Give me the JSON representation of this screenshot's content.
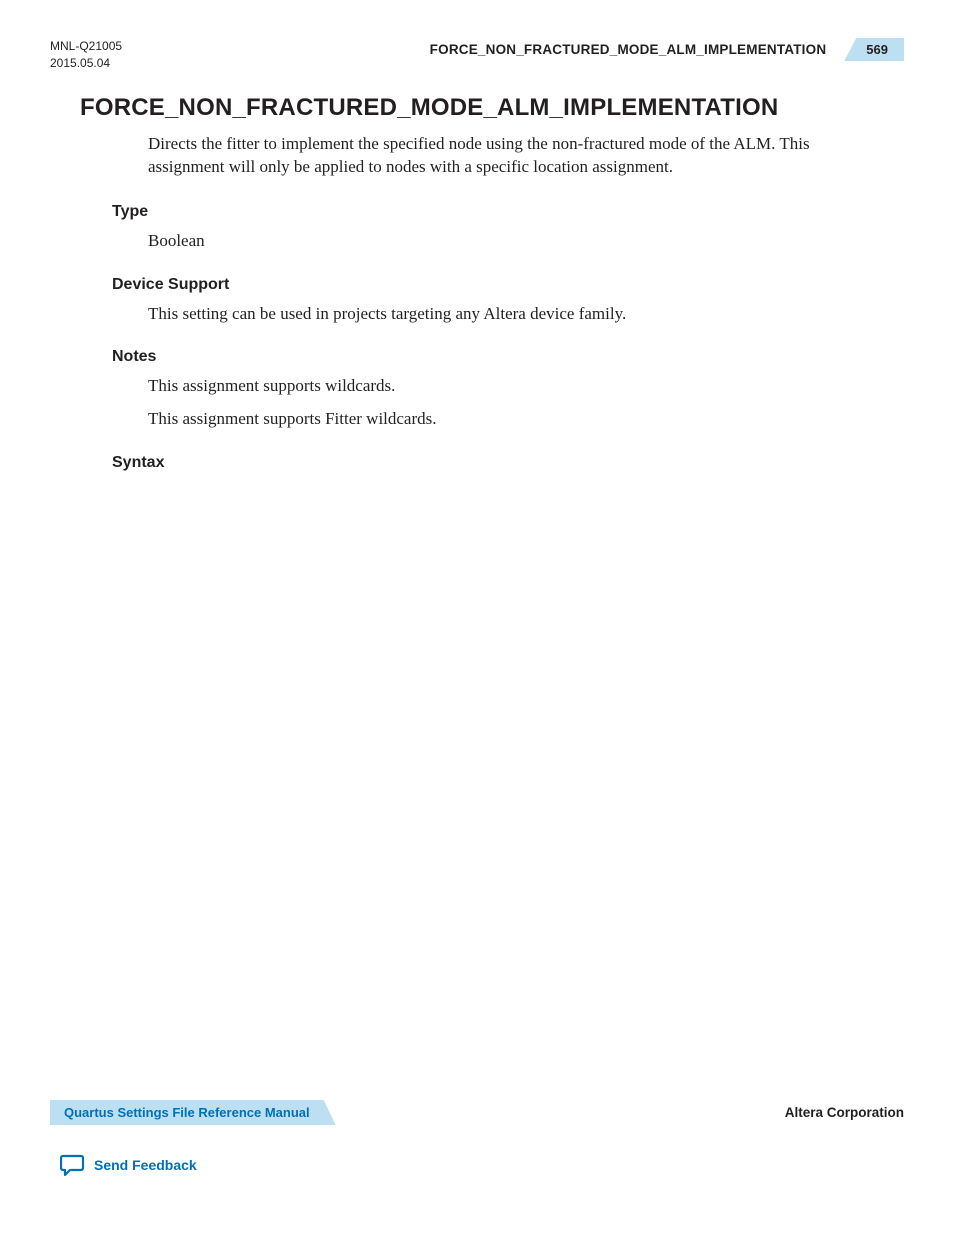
{
  "header": {
    "doc_id": "MNL-Q21005",
    "date": "2015.05.04",
    "running_title": "FORCE_NON_FRACTURED_MODE_ALM_IMPLEMENTATION",
    "page_number": "569"
  },
  "title": "FORCE_NON_FRACTURED_MODE_ALM_IMPLEMENTATION",
  "intro": "Directs the fitter to implement the specified node using the non-fractured mode of the ALM. This assignment will only be applied to nodes with a specific location assignment.",
  "sections": {
    "type": {
      "heading": "Type",
      "body": "Boolean"
    },
    "device_support": {
      "heading": "Device Support",
      "body": "This setting can be used in projects targeting any Altera device family."
    },
    "notes": {
      "heading": "Notes",
      "line1": "This assignment supports wildcards.",
      "line2": "This assignment supports Fitter wildcards."
    },
    "syntax": {
      "heading": "Syntax"
    }
  },
  "footer": {
    "manual_title": "Quartus Settings File Reference Manual",
    "company": "Altera Corporation",
    "feedback_label": "Send Feedback"
  }
}
